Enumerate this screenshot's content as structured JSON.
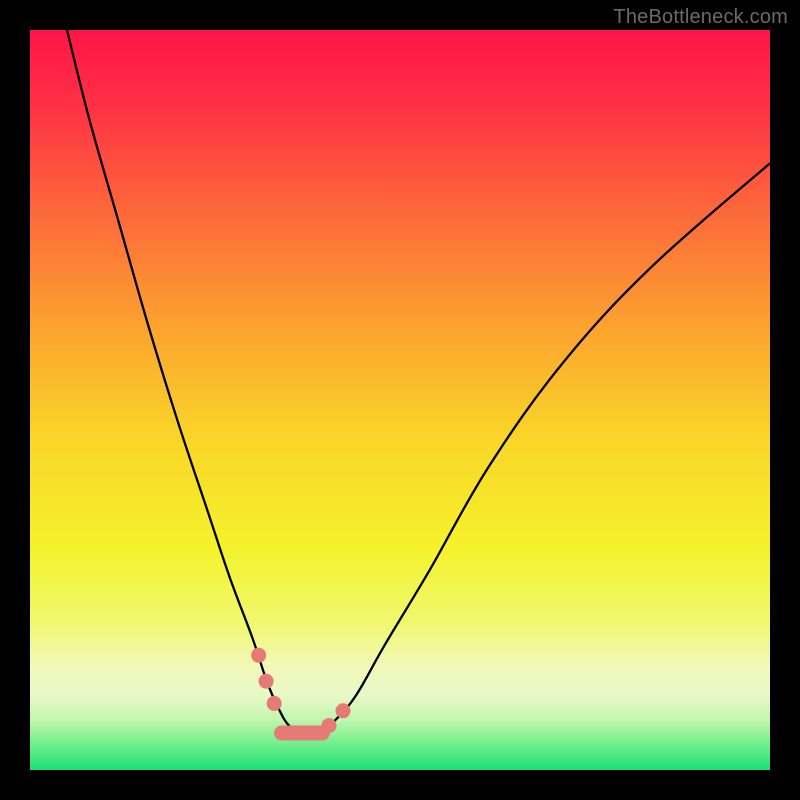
{
  "watermark": "TheBottleneck.com",
  "colors": {
    "frame": "#000000",
    "curve_stroke": "#000000",
    "marker_fill": "#e67a77",
    "marker_stroke": "#b54f4a",
    "gradient_stops": [
      {
        "offset": 0.0,
        "color": "#ff1549"
      },
      {
        "offset": 0.1,
        "color": "#ff3045"
      },
      {
        "offset": 0.25,
        "color": "#fd6a3a"
      },
      {
        "offset": 0.4,
        "color": "#fca22f"
      },
      {
        "offset": 0.55,
        "color": "#fad528"
      },
      {
        "offset": 0.7,
        "color": "#f4f22a"
      },
      {
        "offset": 0.8,
        "color": "#f0f86f"
      },
      {
        "offset": 0.86,
        "color": "#f2f8b8"
      },
      {
        "offset": 0.9,
        "color": "#e8f8c8"
      },
      {
        "offset": 0.93,
        "color": "#c6f6b0"
      },
      {
        "offset": 0.96,
        "color": "#7ef090"
      },
      {
        "offset": 1.0,
        "color": "#18e276"
      }
    ]
  },
  "chart_data": {
    "type": "line",
    "title": "",
    "xlabel": "",
    "ylabel": "",
    "xlim": [
      0,
      100
    ],
    "ylim": [
      0,
      100
    ],
    "grid": false,
    "legend": false,
    "series": [
      {
        "name": "bottleneck-curve",
        "x": [
          5,
          8,
          12,
          16,
          20,
          24,
          27,
          30,
          32,
          33.5,
          35,
          37,
          39,
          41,
          44,
          48,
          54,
          62,
          72,
          84,
          100
        ],
        "y": [
          100,
          88,
          74,
          60,
          47,
          35,
          26,
          18,
          12,
          8.5,
          6,
          5,
          5,
          6.5,
          10,
          17,
          27,
          41,
          55,
          68,
          82
        ]
      }
    ],
    "annotations": {
      "markers": [
        {
          "x": 30.9,
          "y": 15.5
        },
        {
          "x": 31.9,
          "y": 12.0
        },
        {
          "x": 33.0,
          "y": 9.0
        },
        {
          "x": 40.4,
          "y": 6.0
        },
        {
          "x": 42.3,
          "y": 8.0
        }
      ],
      "flat_bottom": {
        "x0": 34.0,
        "x1": 39.5,
        "y": 5.0
      }
    }
  }
}
